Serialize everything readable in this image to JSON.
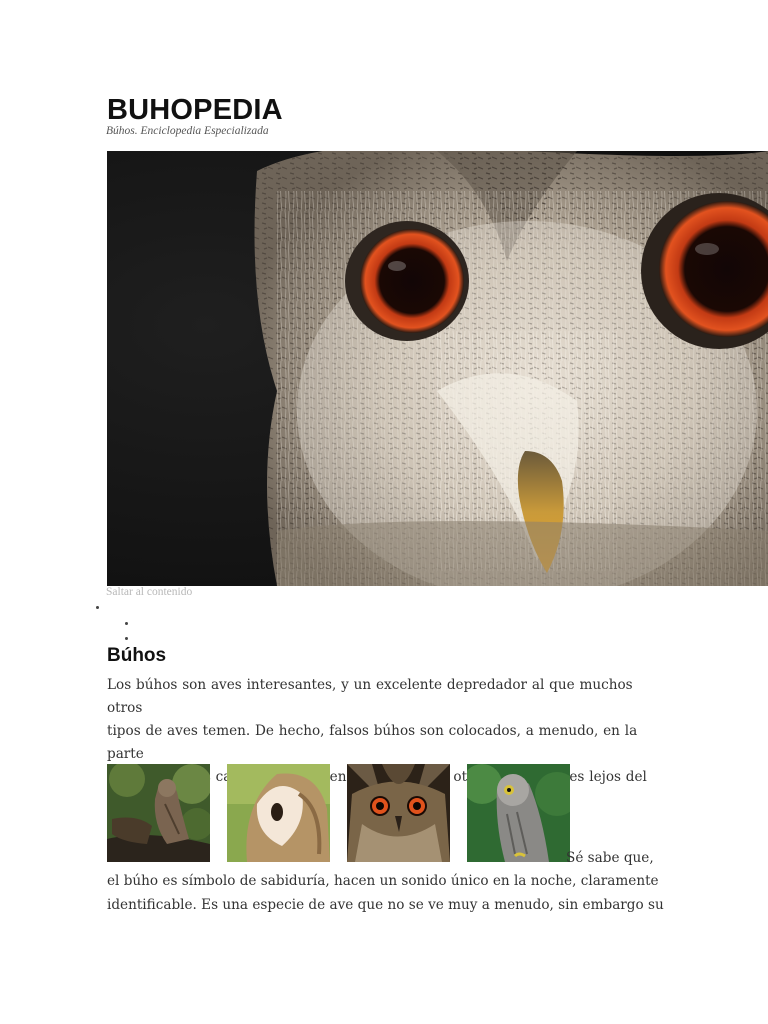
{
  "header": {
    "site_title": "BUHOPEDIA",
    "tagline": "Búhos. Enciclopedia Especializada"
  },
  "skip_link": "Saltar al contenido",
  "article": {
    "heading": "Búhos",
    "intro_line_1": "Los búhos son aves interesantes, y un  excelente depredador al que muchos otros",
    "intro_line_2": "tipos de aves temen. De hecho, falsos búhos son colocados, a menudo, en la parte",
    "intro_line_3": "superior de las casas para mantener a palomas y otros tipos de aves lejos del lugar.",
    "continued_start": "Sé sabe que,",
    "continued_line_1": "el búho es símbolo de sabiduría, hacen un sonido único en la noche, claramente",
    "continued_line_2": "identificable. Es una especie de ave que no se ve muy a menudo, sin embargo su"
  },
  "colors": {
    "title": "#111111",
    "body_text": "#333333",
    "skip_link": "#b8b8b8",
    "owl_eye": "#d9481c"
  }
}
